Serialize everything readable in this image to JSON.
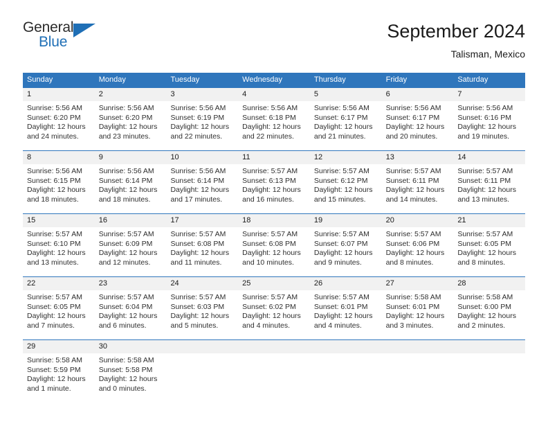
{
  "brand": {
    "name_part1": "General",
    "name_part2": "Blue",
    "triangle_color": "#1f6fb6"
  },
  "header": {
    "title": "September 2024",
    "subtitle": "Talisman, Mexico"
  },
  "colors": {
    "header_bar": "#2f76bc",
    "day_band": "#f1f1f1",
    "text": "#2e2e2e",
    "brand_blue": "#1f6fb6"
  },
  "weekdays": [
    "Sunday",
    "Monday",
    "Tuesday",
    "Wednesday",
    "Thursday",
    "Friday",
    "Saturday"
  ],
  "weeks": [
    [
      {
        "day": "1",
        "sunrise": "Sunrise: 5:56 AM",
        "sunset": "Sunset: 6:20 PM",
        "daylight_line1": "Daylight: 12 hours",
        "daylight_line2": "and 24 minutes."
      },
      {
        "day": "2",
        "sunrise": "Sunrise: 5:56 AM",
        "sunset": "Sunset: 6:20 PM",
        "daylight_line1": "Daylight: 12 hours",
        "daylight_line2": "and 23 minutes."
      },
      {
        "day": "3",
        "sunrise": "Sunrise: 5:56 AM",
        "sunset": "Sunset: 6:19 PM",
        "daylight_line1": "Daylight: 12 hours",
        "daylight_line2": "and 22 minutes."
      },
      {
        "day": "4",
        "sunrise": "Sunrise: 5:56 AM",
        "sunset": "Sunset: 6:18 PM",
        "daylight_line1": "Daylight: 12 hours",
        "daylight_line2": "and 22 minutes."
      },
      {
        "day": "5",
        "sunrise": "Sunrise: 5:56 AM",
        "sunset": "Sunset: 6:17 PM",
        "daylight_line1": "Daylight: 12 hours",
        "daylight_line2": "and 21 minutes."
      },
      {
        "day": "6",
        "sunrise": "Sunrise: 5:56 AM",
        "sunset": "Sunset: 6:17 PM",
        "daylight_line1": "Daylight: 12 hours",
        "daylight_line2": "and 20 minutes."
      },
      {
        "day": "7",
        "sunrise": "Sunrise: 5:56 AM",
        "sunset": "Sunset: 6:16 PM",
        "daylight_line1": "Daylight: 12 hours",
        "daylight_line2": "and 19 minutes."
      }
    ],
    [
      {
        "day": "8",
        "sunrise": "Sunrise: 5:56 AM",
        "sunset": "Sunset: 6:15 PM",
        "daylight_line1": "Daylight: 12 hours",
        "daylight_line2": "and 18 minutes."
      },
      {
        "day": "9",
        "sunrise": "Sunrise: 5:56 AM",
        "sunset": "Sunset: 6:14 PM",
        "daylight_line1": "Daylight: 12 hours",
        "daylight_line2": "and 18 minutes."
      },
      {
        "day": "10",
        "sunrise": "Sunrise: 5:56 AM",
        "sunset": "Sunset: 6:14 PM",
        "daylight_line1": "Daylight: 12 hours",
        "daylight_line2": "and 17 minutes."
      },
      {
        "day": "11",
        "sunrise": "Sunrise: 5:57 AM",
        "sunset": "Sunset: 6:13 PM",
        "daylight_line1": "Daylight: 12 hours",
        "daylight_line2": "and 16 minutes."
      },
      {
        "day": "12",
        "sunrise": "Sunrise: 5:57 AM",
        "sunset": "Sunset: 6:12 PM",
        "daylight_line1": "Daylight: 12 hours",
        "daylight_line2": "and 15 minutes."
      },
      {
        "day": "13",
        "sunrise": "Sunrise: 5:57 AM",
        "sunset": "Sunset: 6:11 PM",
        "daylight_line1": "Daylight: 12 hours",
        "daylight_line2": "and 14 minutes."
      },
      {
        "day": "14",
        "sunrise": "Sunrise: 5:57 AM",
        "sunset": "Sunset: 6:11 PM",
        "daylight_line1": "Daylight: 12 hours",
        "daylight_line2": "and 13 minutes."
      }
    ],
    [
      {
        "day": "15",
        "sunrise": "Sunrise: 5:57 AM",
        "sunset": "Sunset: 6:10 PM",
        "daylight_line1": "Daylight: 12 hours",
        "daylight_line2": "and 13 minutes."
      },
      {
        "day": "16",
        "sunrise": "Sunrise: 5:57 AM",
        "sunset": "Sunset: 6:09 PM",
        "daylight_line1": "Daylight: 12 hours",
        "daylight_line2": "and 12 minutes."
      },
      {
        "day": "17",
        "sunrise": "Sunrise: 5:57 AM",
        "sunset": "Sunset: 6:08 PM",
        "daylight_line1": "Daylight: 12 hours",
        "daylight_line2": "and 11 minutes."
      },
      {
        "day": "18",
        "sunrise": "Sunrise: 5:57 AM",
        "sunset": "Sunset: 6:08 PM",
        "daylight_line1": "Daylight: 12 hours",
        "daylight_line2": "and 10 minutes."
      },
      {
        "day": "19",
        "sunrise": "Sunrise: 5:57 AM",
        "sunset": "Sunset: 6:07 PM",
        "daylight_line1": "Daylight: 12 hours",
        "daylight_line2": "and 9 minutes."
      },
      {
        "day": "20",
        "sunrise": "Sunrise: 5:57 AM",
        "sunset": "Sunset: 6:06 PM",
        "daylight_line1": "Daylight: 12 hours",
        "daylight_line2": "and 8 minutes."
      },
      {
        "day": "21",
        "sunrise": "Sunrise: 5:57 AM",
        "sunset": "Sunset: 6:05 PM",
        "daylight_line1": "Daylight: 12 hours",
        "daylight_line2": "and 8 minutes."
      }
    ],
    [
      {
        "day": "22",
        "sunrise": "Sunrise: 5:57 AM",
        "sunset": "Sunset: 6:05 PM",
        "daylight_line1": "Daylight: 12 hours",
        "daylight_line2": "and 7 minutes."
      },
      {
        "day": "23",
        "sunrise": "Sunrise: 5:57 AM",
        "sunset": "Sunset: 6:04 PM",
        "daylight_line1": "Daylight: 12 hours",
        "daylight_line2": "and 6 minutes."
      },
      {
        "day": "24",
        "sunrise": "Sunrise: 5:57 AM",
        "sunset": "Sunset: 6:03 PM",
        "daylight_line1": "Daylight: 12 hours",
        "daylight_line2": "and 5 minutes."
      },
      {
        "day": "25",
        "sunrise": "Sunrise: 5:57 AM",
        "sunset": "Sunset: 6:02 PM",
        "daylight_line1": "Daylight: 12 hours",
        "daylight_line2": "and 4 minutes."
      },
      {
        "day": "26",
        "sunrise": "Sunrise: 5:57 AM",
        "sunset": "Sunset: 6:01 PM",
        "daylight_line1": "Daylight: 12 hours",
        "daylight_line2": "and 4 minutes."
      },
      {
        "day": "27",
        "sunrise": "Sunrise: 5:58 AM",
        "sunset": "Sunset: 6:01 PM",
        "daylight_line1": "Daylight: 12 hours",
        "daylight_line2": "and 3 minutes."
      },
      {
        "day": "28",
        "sunrise": "Sunrise: 5:58 AM",
        "sunset": "Sunset: 6:00 PM",
        "daylight_line1": "Daylight: 12 hours",
        "daylight_line2": "and 2 minutes."
      }
    ],
    [
      {
        "day": "29",
        "sunrise": "Sunrise: 5:58 AM",
        "sunset": "Sunset: 5:59 PM",
        "daylight_line1": "Daylight: 12 hours",
        "daylight_line2": "and 1 minute."
      },
      {
        "day": "30",
        "sunrise": "Sunrise: 5:58 AM",
        "sunset": "Sunset: 5:58 PM",
        "daylight_line1": "Daylight: 12 hours",
        "daylight_line2": "and 0 minutes."
      },
      {
        "day": "",
        "sunrise": "",
        "sunset": "",
        "daylight_line1": "",
        "daylight_line2": ""
      },
      {
        "day": "",
        "sunrise": "",
        "sunset": "",
        "daylight_line1": "",
        "daylight_line2": ""
      },
      {
        "day": "",
        "sunrise": "",
        "sunset": "",
        "daylight_line1": "",
        "daylight_line2": ""
      },
      {
        "day": "",
        "sunrise": "",
        "sunset": "",
        "daylight_line1": "",
        "daylight_line2": ""
      },
      {
        "day": "",
        "sunrise": "",
        "sunset": "",
        "daylight_line1": "",
        "daylight_line2": ""
      }
    ]
  ]
}
